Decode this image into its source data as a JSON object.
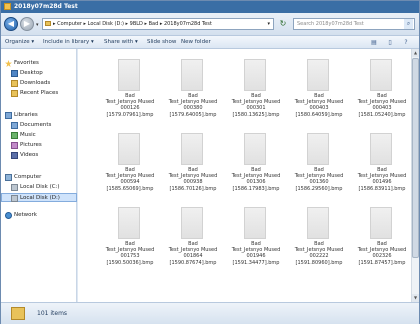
{
  "window": {
    "title": "2018y07m28d Test"
  },
  "address": {
    "breadcrumb": "▸ Computer ▸ Local Disk (D:) ▸ 9BLD ▸ Bad ▸ 2018y07m28d Test",
    "search_placeholder": "Search 2018y07m28d Test"
  },
  "toolbar": {
    "organize": "Organize ▾",
    "include_in_library": "Include in library ▾",
    "share_with": "Share with ▾",
    "slide_show": "Slide show",
    "new_folder": "New folder"
  },
  "navpane": {
    "favorites": "Favorites",
    "desktop": "Desktop",
    "downloads": "Downloads",
    "recent_places": "Recent Places",
    "libraries": "Libraries",
    "documents": "Documents",
    "music": "Music",
    "pictures": "Pictures",
    "videos": "Videos",
    "computer": "Computer",
    "local_disk_c": "Local Disk (C:)",
    "local_disk_d": "Local Disk (D:)",
    "network": "Network"
  },
  "files": [
    {
      "line1": "Bad",
      "line2": "Test_Jetsnyo Mused",
      "line3": "000126",
      "line4": "[1579.07961].bmp"
    },
    {
      "line1": "Bad",
      "line2": "Test_Jetsnyo Mused",
      "line3": "000380",
      "line4": "[1579.64005].bmp"
    },
    {
      "line1": "Bad",
      "line2": "Test_Jetsnyo Mused",
      "line3": "000301",
      "line4": "[1580.13625].bmp"
    },
    {
      "line1": "Bad",
      "line2": "Test_Jetsnyo Mused",
      "line3": "000403",
      "line4": "[1580.64059].bmp"
    },
    {
      "line1": "Bad",
      "line2": "Test_Jetsnyo Mused",
      "line3": "000403",
      "line4": "[1581.05240].bmp"
    },
    {
      "line1": "Bad",
      "line2": "Test_Jetsnyo Mused",
      "line3": "000594",
      "line4": "[1585.65069].bmp"
    },
    {
      "line1": "Bad",
      "line2": "Test_Jetsnyo Mused",
      "line3": "000938",
      "line4": "[1586.70126].bmp"
    },
    {
      "line1": "Bad",
      "line2": "Test_Jetsnyo Mused",
      "line3": "001306",
      "line4": "[1586.17983].bmp"
    },
    {
      "line1": "Bad",
      "line2": "Test_Jetsnyo Mused",
      "line3": "001360",
      "line4": "[1586.29560].bmp"
    },
    {
      "line1": "Bad",
      "line2": "Test_Jetsnyo Mused",
      "line3": "001496",
      "line4": "[1586.83911].bmp"
    },
    {
      "line1": "Bad",
      "line2": "Test_Jetsnyo Mused",
      "line3": "001753",
      "line4": "[1590.50036].bmp"
    },
    {
      "line1": "Bad",
      "line2": "Test_Jetsnyo Mused",
      "line3": "001864",
      "line4": "[1590.87674].bmp"
    },
    {
      "line1": "Bad",
      "line2": "Test_Jetsnyo Mused",
      "line3": "001946",
      "line4": "[1591.34477].bmp"
    },
    {
      "line1": "Bad",
      "line2": "Test_Jetsnyo Mused",
      "line3": "002222",
      "line4": "[1591.80960].bmp"
    },
    {
      "line1": "Bad",
      "line2": "Test_Jetsnyo Mused",
      "line3": "002326",
      "line4": "[1591.87457].bmp"
    }
  ],
  "status": {
    "item_count": "101 items"
  },
  "icons": {
    "back": "back-arrow-icon",
    "forward": "forward-arrow-icon",
    "refresh": "refresh-icon",
    "search": "search-icon",
    "view": "view-options-icon",
    "preview": "preview-pane-icon",
    "help": "help-icon"
  },
  "colors": {
    "titlebar": "#3a6ea5",
    "selection": "#cfe3fb",
    "folder": "#e8c25a"
  }
}
